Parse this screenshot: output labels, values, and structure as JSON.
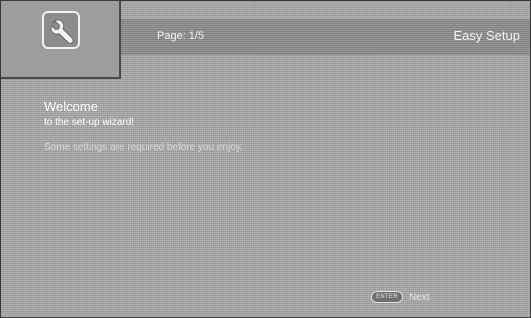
{
  "header": {
    "page_indicator": "Page: 1/5",
    "title": "Easy Setup"
  },
  "header_icon": "wrench-icon",
  "welcome": {
    "title": "Welcome",
    "subtitle": "to the set-up wizard!",
    "note": "Some settings are required before you enjoy."
  },
  "footer": {
    "enter_key_label": "ENTER",
    "next_label": "Next"
  }
}
